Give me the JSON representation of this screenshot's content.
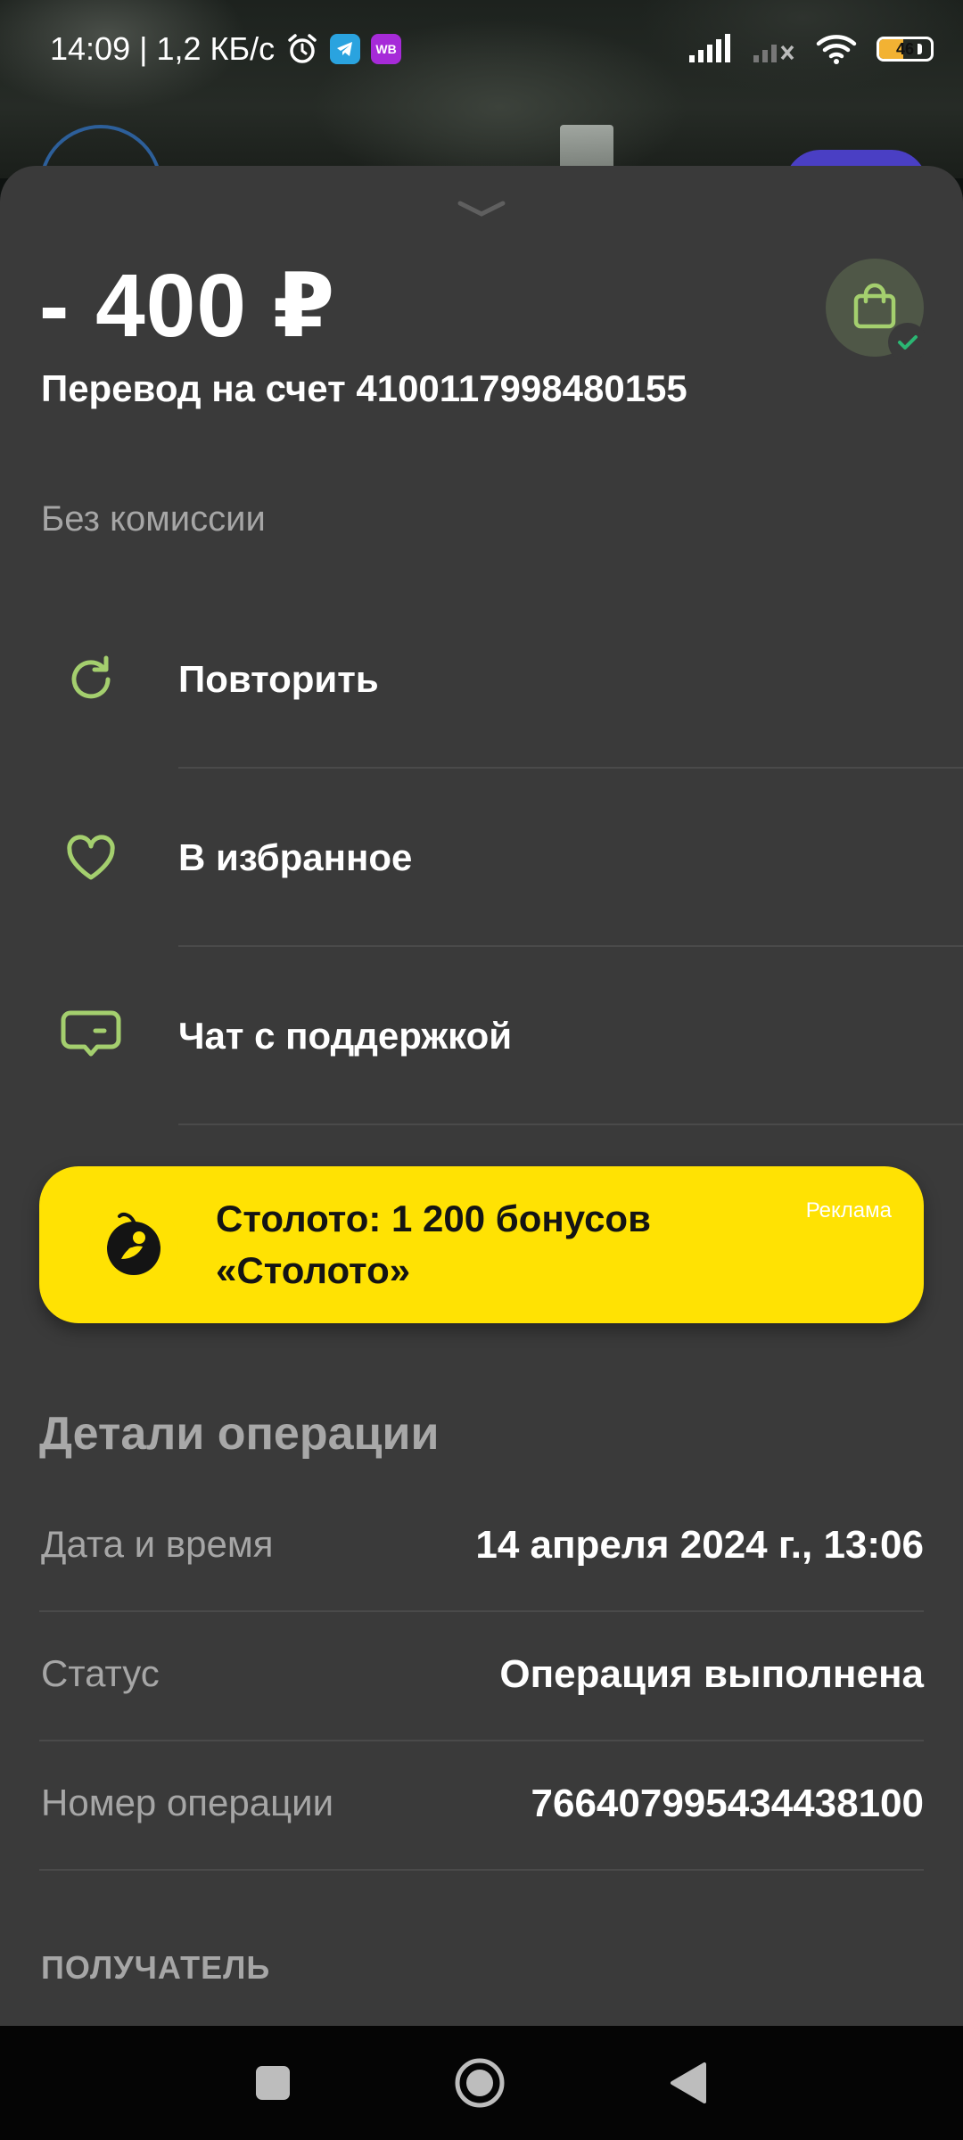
{
  "status_bar": {
    "time_speed": "14:09 | 1,2 КБ/с",
    "wb_label": "WB",
    "battery_level": "46",
    "battery_fraction": 0.46
  },
  "transaction": {
    "amount": "- 400 ₽",
    "description": "Перевод на счет 4100117998480155",
    "commission": "Без комиссии"
  },
  "actions": [
    {
      "label": "Повторить",
      "icon": "repeat-icon"
    },
    {
      "label": "В избранное",
      "icon": "heart-icon"
    },
    {
      "label": "Чат с поддержкой",
      "icon": "chat-icon"
    }
  ],
  "ad": {
    "text": "Столото: 1 200 бонусов «Столото»",
    "tag": "Реклама",
    "icon": "stoloto-logo"
  },
  "details": {
    "title": "Детали операции",
    "rows": [
      {
        "label": "Дата и время",
        "value": "14 апреля 2024 г., 13:06"
      },
      {
        "label": "Статус",
        "value": "Операция выполнена"
      },
      {
        "label": "Номер операции",
        "value": "766407995434438100"
      }
    ],
    "recipient_heading": "ПОЛУЧАТЕЛЬ"
  },
  "colors": {
    "sheet_bg": "#3a3a3a",
    "accent_green": "#a4cf6e",
    "ad_yellow": "#ffe203",
    "muted_text": "#a6a6a6"
  },
  "nav": {
    "buttons": [
      "recent-apps-icon",
      "home-icon",
      "back-icon"
    ]
  }
}
